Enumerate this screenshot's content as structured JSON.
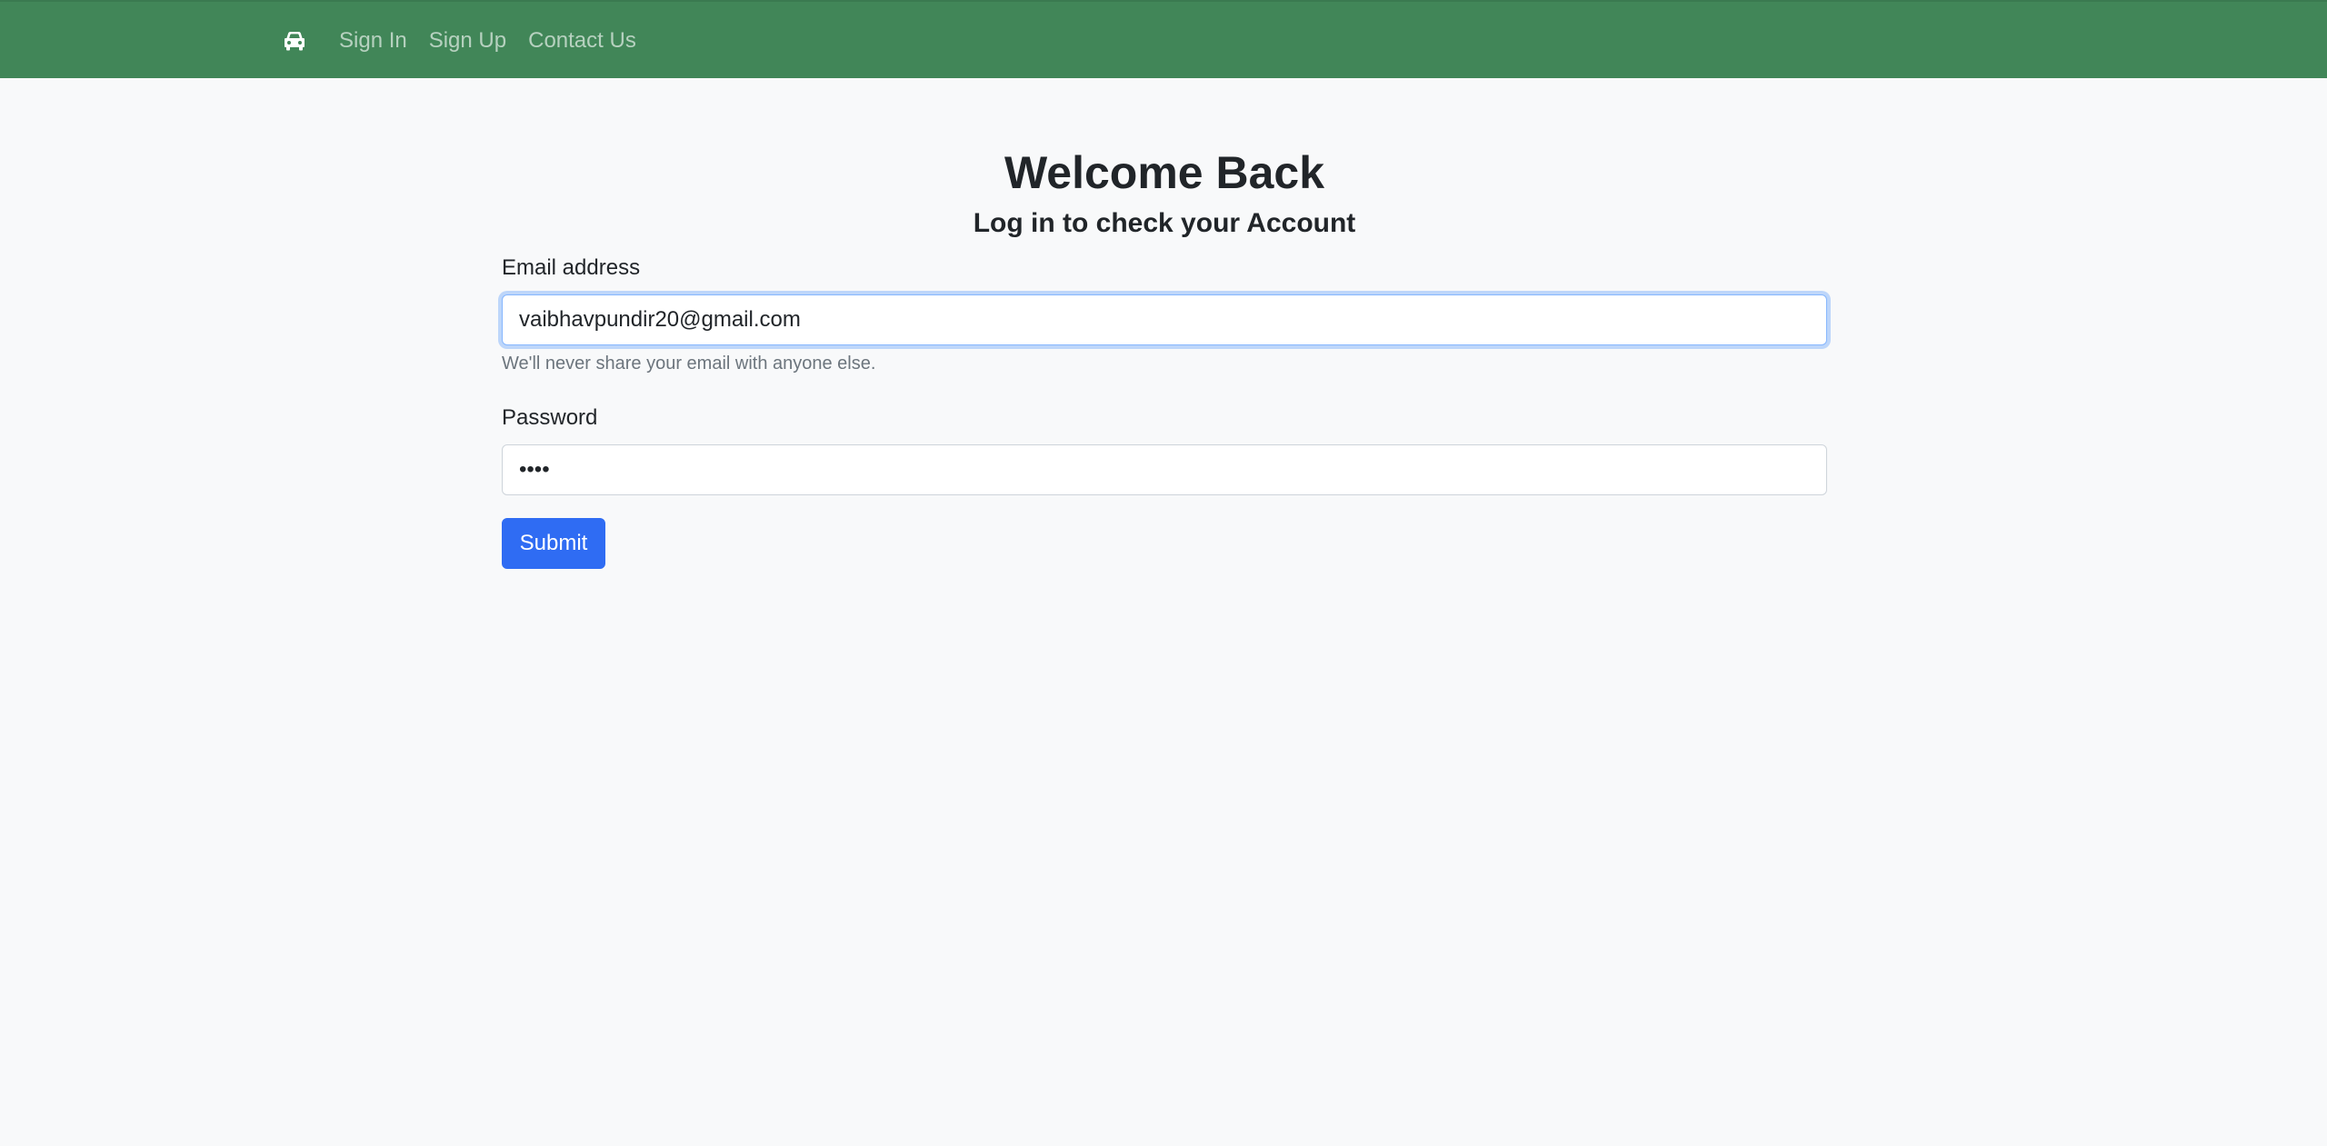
{
  "navbar": {
    "brand_icon": "car-icon",
    "links": [
      {
        "label": "Sign In"
      },
      {
        "label": "Sign Up"
      },
      {
        "label": "Contact Us"
      }
    ],
    "background_color": "#418658"
  },
  "page": {
    "title": "Welcome Back",
    "subtitle": "Log in to check your Account"
  },
  "form": {
    "email": {
      "label": "Email address",
      "value": "vaibhavpundir20@gmail.com",
      "help_text": "We'll never share your email with anyone else."
    },
    "password": {
      "label": "Password",
      "value": "••••"
    },
    "submit_label": "Submit",
    "submit_color": "#2f6cf3"
  }
}
